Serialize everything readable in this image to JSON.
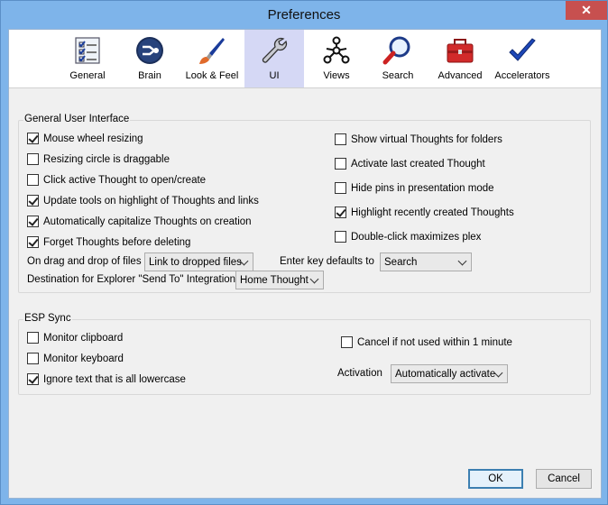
{
  "window": {
    "title": "Preferences"
  },
  "toolbar": [
    {
      "label": "General",
      "icon": "checklist-icon"
    },
    {
      "label": "Brain",
      "icon": "brain-logo-icon"
    },
    {
      "label": "Look & Feel",
      "icon": "paintbrush-icon"
    },
    {
      "label": "UI",
      "icon": "wrench-icon"
    },
    {
      "label": "Views",
      "icon": "views-network-icon"
    },
    {
      "label": "Search",
      "icon": "magnifier-icon"
    },
    {
      "label": "Advanced",
      "icon": "toolbox-icon"
    },
    {
      "label": "Accelerators",
      "icon": "checkmark-icon"
    }
  ],
  "general_ui": {
    "legend": "General User Interface",
    "left_checks": [
      {
        "label": "Mouse wheel resizing",
        "checked": true
      },
      {
        "label": "Resizing circle is draggable",
        "checked": false
      },
      {
        "label": "Click active Thought to open/create",
        "checked": false
      },
      {
        "label": "Update tools on highlight of Thoughts and links",
        "checked": true
      },
      {
        "label": "Automatically capitalize Thoughts on creation",
        "checked": true
      },
      {
        "label": "Forget Thoughts before deleting",
        "checked": true
      }
    ],
    "right_checks": [
      {
        "label": "Show virtual Thoughts for folders",
        "checked": false
      },
      {
        "label": "Activate last created Thought",
        "checked": false
      },
      {
        "label": "Hide pins in presentation mode",
        "checked": false
      },
      {
        "label": "Highlight recently created Thoughts",
        "checked": true
      },
      {
        "label": "Double-click maximizes plex",
        "checked": false
      }
    ],
    "drag_drop_label": "On drag and drop of files",
    "drag_drop_value": "Link to dropped files",
    "enter_key_label": "Enter key defaults to",
    "enter_key_value": "Search",
    "send_to_label": "Destination for Explorer \"Send To\" Integration",
    "send_to_value": "Home Thought"
  },
  "esp_sync": {
    "legend": "ESP Sync",
    "checks": [
      {
        "label": "Monitor clipboard",
        "checked": false
      },
      {
        "label": "Monitor keyboard",
        "checked": false
      },
      {
        "label": "Ignore text that is all lowercase",
        "checked": true
      }
    ],
    "cancel_check": {
      "label": "Cancel if not used within 1 minute",
      "checked": false
    },
    "activation_label": "Activation",
    "activation_value": "Automatically activate"
  },
  "buttons": {
    "ok": "OK",
    "cancel": "Cancel"
  },
  "colors": {
    "active_tab": "#d5d8f5",
    "title_bar": "#7eb4ea",
    "close": "#c7504f"
  }
}
